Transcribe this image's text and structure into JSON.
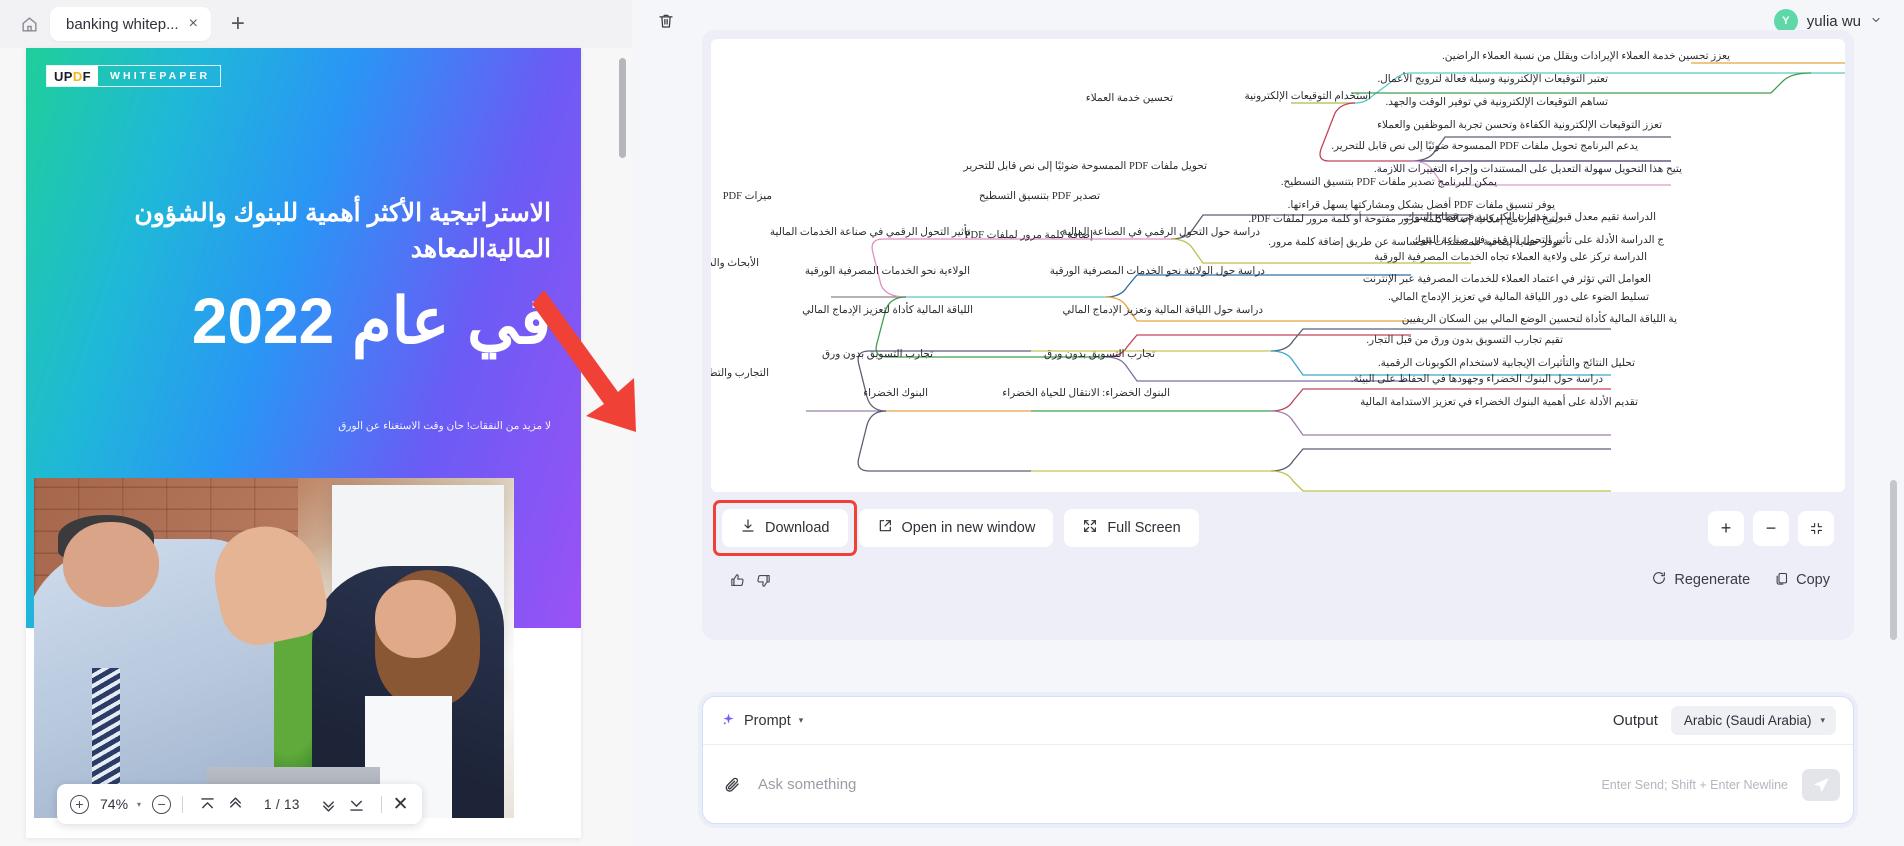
{
  "browser": {
    "home_icon": "home-icon",
    "tab_title": "banking whitep...",
    "tab_close": "×",
    "new_tab": "+"
  },
  "account": {
    "avatar_initial": "Y",
    "name": "yulia wu",
    "caret": "⌄"
  },
  "pdf": {
    "logo_up": "UP",
    "logo_d": "D",
    "logo_f": "F",
    "logo_label": "WHITEPAPER",
    "title": "الاستراتيجية الأكثر أهمية للبنوك والشؤون الماليةالمعاهد",
    "year_line": "في عام 2022",
    "subtitle": "لا مزيد من النفقات! حان وقت الاستغناء عن الورق",
    "toolbar": {
      "zoom_in": "+",
      "zoom_value": "74%",
      "zoom_caret": "▾",
      "zoom_out": "−",
      "first_page_icon": "first-page-icon",
      "prev_page_icon": "prev-page-icon",
      "page_indicator": "1 / 13",
      "next_page_icon": "next-page-icon",
      "last_page_icon": "last-page-icon",
      "close": "✕"
    }
  },
  "answer": {
    "delete_icon": "trash-icon",
    "actions": {
      "download": "Download",
      "open_new_window": "Open in new window",
      "full_screen": "Full Screen",
      "zoom_in": "+",
      "zoom_out": "−",
      "fit_icon": "fit-screen-icon"
    },
    "feedback": {
      "thumbs_up": "thumbs-up-icon",
      "thumbs_down": "thumbs-down-icon",
      "regenerate": "Regenerate",
      "copy": "Copy"
    }
  },
  "mindmap": {
    "branches": [
      {
        "root": "تحسين خدمة العملاء",
        "nodes": [
          {
            "mid": "",
            "leaves": [
              "يعزز تحسين خدمة العملاء الإيرادات ويقلل من نسبة العملاء الراضين."
            ]
          },
          {
            "mid": "استخدام التوقيعات الإلكترونية",
            "leaves": [
              "تعتبر التوقيعات الإلكترونية وسيلة فعالة لترويج الأعمال.",
              "تساهم التوقيعات الإلكترونية في توفير الوقت والجهد.",
              "تعزز التوقيعات الإلكترونية الكفاءة وتحسن تجربة الموظفين والعملاء"
            ]
          }
        ]
      },
      {
        "root": "ميزات PDF",
        "nodes": [
          {
            "mid": "تحويل ملفات PDF الممسوحة ضوئيًا إلى نص قابل للتحرير",
            "leaves": [
              "يدعم البرنامج تحويل ملفات PDF الممسوحة ضوئيًا إلى نص قابل للتحرير.",
              "يتيح هذا التحويل سهولة التعديل على المستندات وإجراء التغييرات اللازمة."
            ]
          },
          {
            "mid": "تصدير PDF بتنسيق التسطيح",
            "leaves": [
              "يمكن للبرنامج تصدير ملفات PDF بتنسيق التسطيح.",
              "يوفر تنسيق ملفات PDF أفضل بشكل ومشاركتها يسهل قراءتها."
            ]
          },
          {
            "mid": "إضافة كلمة مرور لملفات PDF",
            "leaves": [
              "يتيح البرنامج إمكانية إضافة كلمة مرور مفتوحة أو كلمة مرور لملفات PDF.",
              "توفر حماية إضافية للمستندات الحساسة عن طريق إضافة كلمة مرور."
            ]
          }
        ]
      },
      {
        "root": "الأبحاث والدراسات",
        "nodes": [
          {
            "mid": "تأثير التحول الرقمي في صناعة الخدمات المالية",
            "mid2": "دراسة حول التحول الرقمي في الصناعة المالية",
            "leaves": [
              "الدراسة تقيم معدل قبول خدمات الكترونية في قطاع البنوك.",
              "ج الدراسة الأدلة على تأثير التحول الرقمي في صناعة البنوك"
            ]
          },
          {
            "mid": "الولاءية نحو الخدمات المصرفية الورقية",
            "mid2": "دراسة حول الولائية نحو الخدمات المصرفية الورقية",
            "leaves": [
              "الدراسة تركز على ولاءية العملاء تجاه الخدمات المصرفية الورقية",
              "العوامل التي تؤثر في اعتماد العملاء للخدمات المصرفية عبر الإنترنت"
            ]
          },
          {
            "mid": "اللياقة المالية كأداة لتعزيز الإدماج المالي",
            "mid2": "دراسة حول اللياقة المالية وتعزيز الإدماج المالي",
            "leaves": [
              "تسليط الضوء على دور اللياقة المالية في تعزيز الإدماج المالي.",
              "ية اللياقة المالية كأداة لتحسين الوضع المالي بين السكان الريفيين"
            ]
          }
        ]
      },
      {
        "root": "التجارب والتطبيقات",
        "nodes": [
          {
            "mid": "تجارب التسويق بدون ورق",
            "mid2": "تجارب التسويق بدون ورق",
            "leaves": [
              "تقيم تجارب التسويق بدون ورق من قبل التجار.",
              "تحليل النتائج والتأثيرات الإيجابية لاستخدام الكوبونات الرقمية."
            ]
          },
          {
            "mid": "البنوك الخضراء",
            "mid2": "البنوك الخضراء: الانتقال للحياة الخضراء",
            "leaves": [
              "دراسة حول البنوك الخضراء وجهودها في الحفاظ على البيئة.",
              "تقديم الأدلة على أهمية البنوك الخضراء في تعزيز الاستدامة المالية"
            ]
          }
        ]
      }
    ]
  },
  "prompt": {
    "sparkle_icon": "sparkle-icon",
    "mode_label": "Prompt",
    "mode_caret": "▾",
    "output_label": "Output",
    "language": "Arabic (Saudi Arabia)",
    "language_caret": "▾",
    "attach_icon": "paperclip-icon",
    "input_value": "",
    "input_placeholder": "Ask something",
    "send_hint": "Enter Send; Shift + Enter Newline",
    "send_icon": "send-icon"
  },
  "colors": {
    "accent": "#7b5cf0",
    "highlight_ring": "#ef4136",
    "avatar": "#5fd8a7",
    "card_bg": "#edeef8"
  }
}
